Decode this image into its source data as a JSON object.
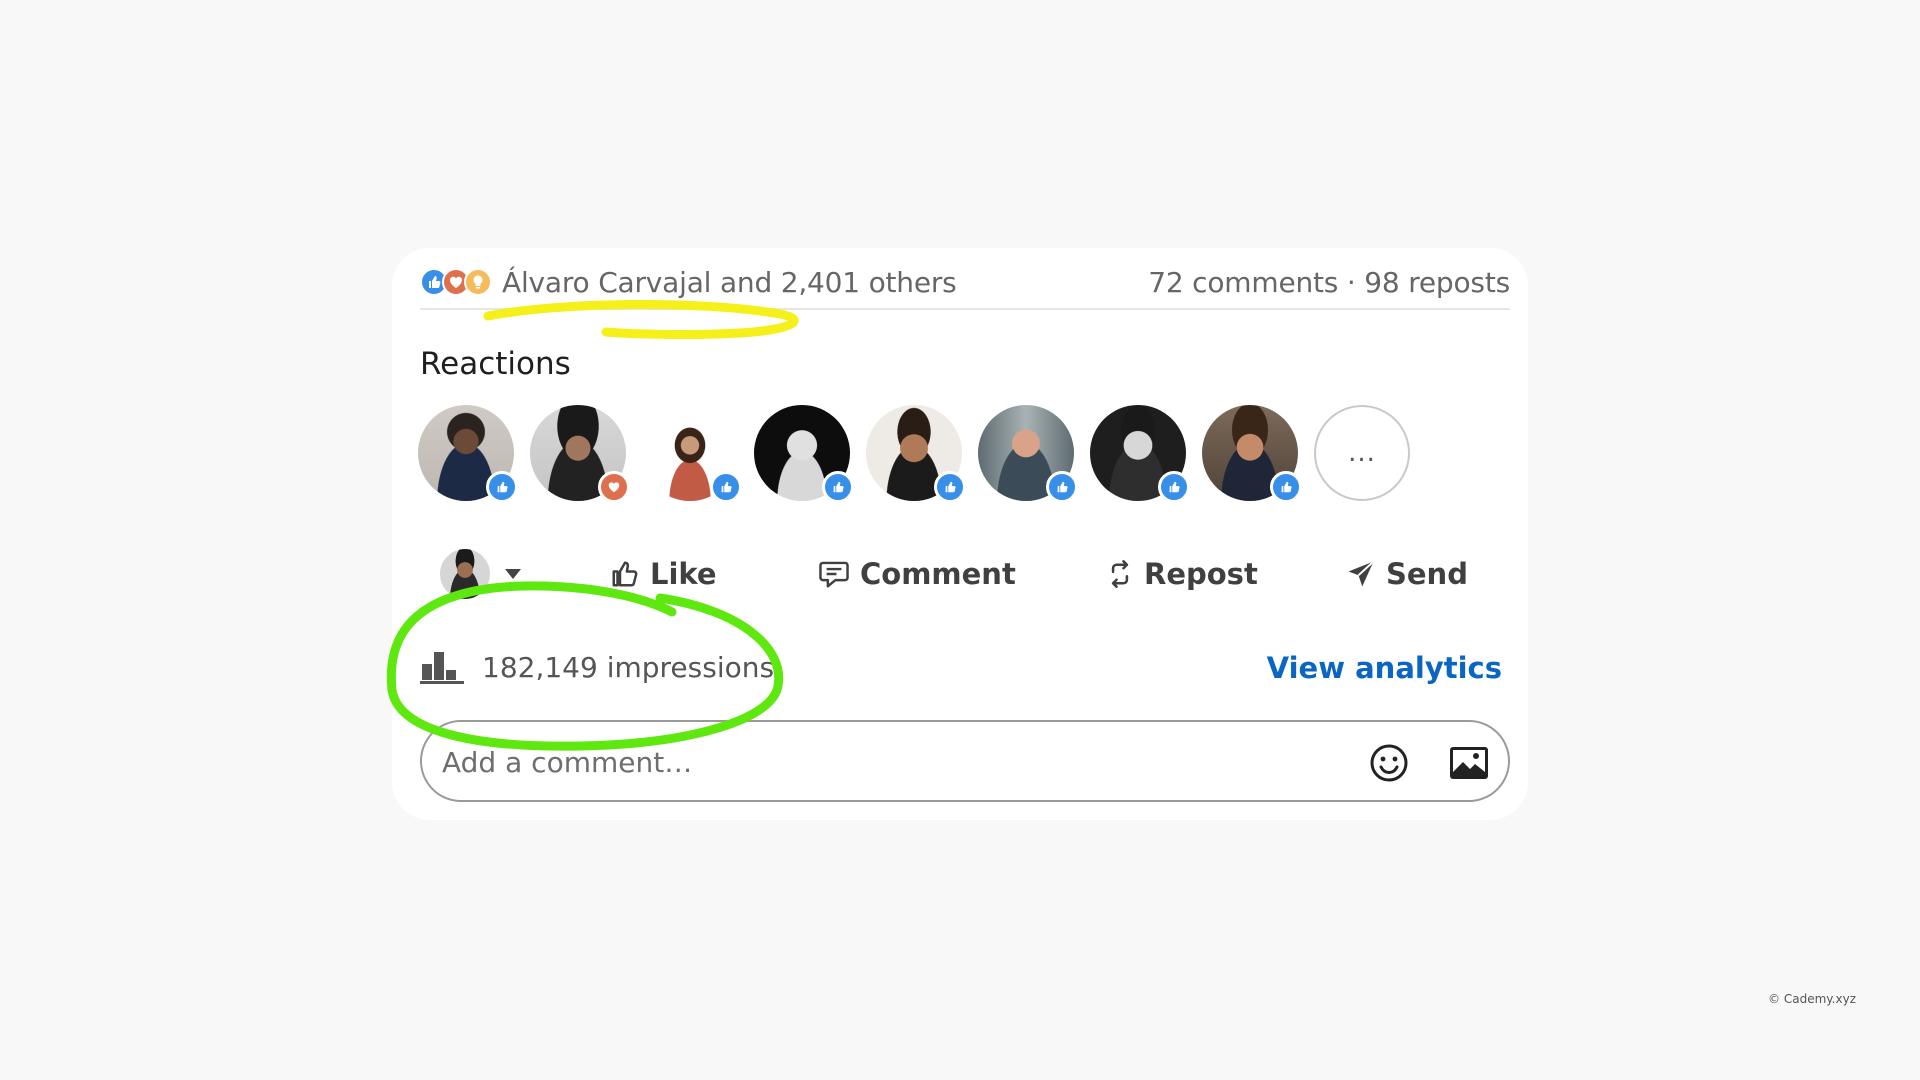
{
  "social": {
    "reactions_text": "Álvaro Carvajal and 2,401 others",
    "comments_reposts": "72 comments · 98 reposts",
    "reaction_types": [
      "like",
      "love",
      "insightful"
    ]
  },
  "reactions": {
    "title": "Reactions",
    "people": [
      {
        "reaction": "like"
      },
      {
        "reaction": "love"
      },
      {
        "reaction": "like"
      },
      {
        "reaction": "like"
      },
      {
        "reaction": "like"
      },
      {
        "reaction": "like"
      },
      {
        "reaction": "like"
      },
      {
        "reaction": "like"
      }
    ],
    "more_label": "..."
  },
  "actions": {
    "like": "Like",
    "comment": "Comment",
    "repost": "Repost",
    "send": "Send"
  },
  "stats": {
    "impressions": "182,149 impressions",
    "view_analytics": "View analytics"
  },
  "comment_box": {
    "placeholder": "Add a comment…",
    "emoji_icon": "emoji-icon",
    "image_icon": "image-icon"
  },
  "colors": {
    "brand_blue": "#0a66c2",
    "like_badge": "#378fe9",
    "love_badge": "#df704d",
    "insight_badge": "#f5bb5c",
    "highlight_yellow": "#f5f01a",
    "highlight_green": "#5fe80f"
  },
  "footer": {
    "copyright": "© Cademy.xyz"
  }
}
